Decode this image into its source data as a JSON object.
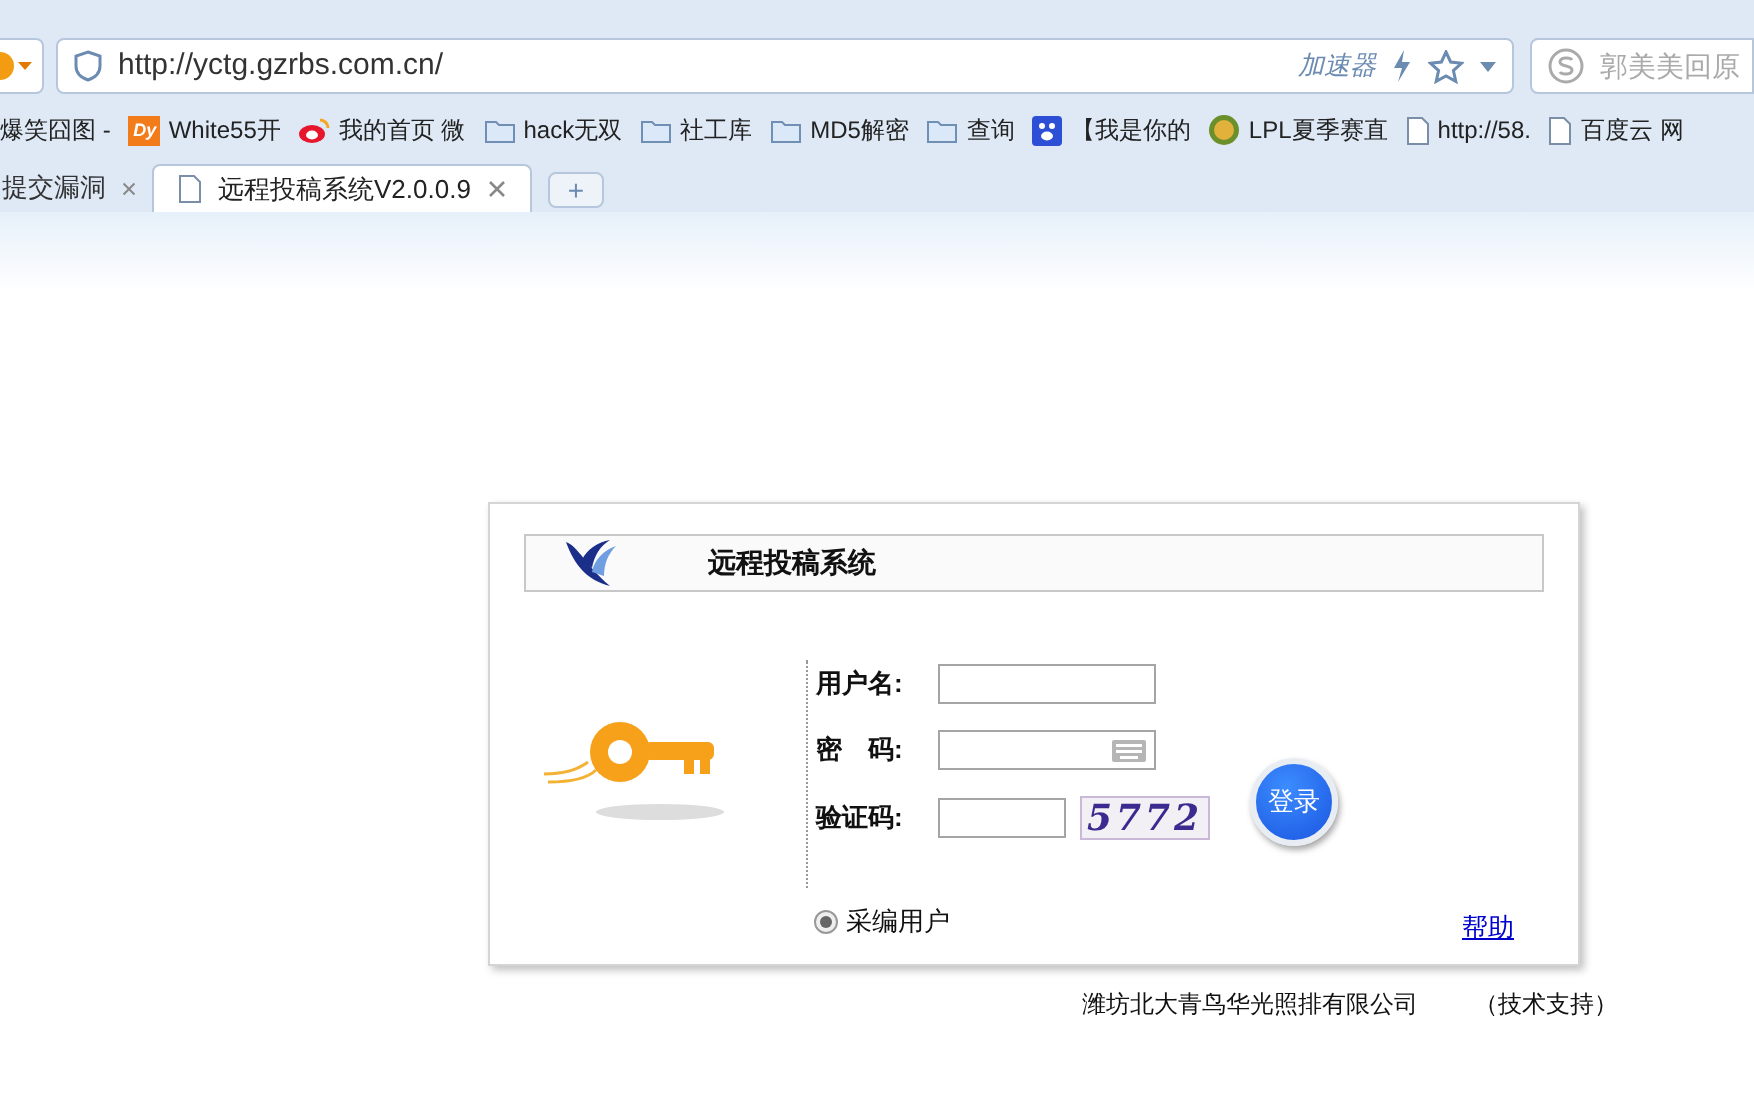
{
  "browser": {
    "address": "http://yctg.gzrbs.com.cn/",
    "accelerator": "加速器",
    "search_placeholder": "郭美美回原",
    "bookmarks": [
      {
        "label": "爆笑囧图 -",
        "kind": "none"
      },
      {
        "label": "White55开",
        "kind": "dy"
      },
      {
        "label": "我的首页 微",
        "kind": "weibo"
      },
      {
        "label": "hack无双",
        "kind": "folder"
      },
      {
        "label": "社工库",
        "kind": "folder"
      },
      {
        "label": "MD5解密",
        "kind": "folder"
      },
      {
        "label": "查询",
        "kind": "folder"
      },
      {
        "label": "【我是你的",
        "kind": "paw"
      },
      {
        "label": "LPL夏季赛直",
        "kind": "game"
      },
      {
        "label": "http://58.",
        "kind": "page"
      },
      {
        "label": "百度云 网",
        "kind": "page"
      }
    ],
    "dy_badge": "Dy",
    "tabs": [
      {
        "label": "提交漏洞",
        "selected": false
      },
      {
        "label": "远程投稿系统V2.0.0.9",
        "selected": true
      }
    ],
    "new_tab": "+"
  },
  "login": {
    "title": "远程投稿系统",
    "fields": [
      {
        "label": "用户名:",
        "kind": "text"
      },
      {
        "label": "密　码:",
        "kind": "password"
      },
      {
        "label": "验证码:",
        "kind": "captcha"
      }
    ],
    "captcha": "5772",
    "submit": "登录",
    "roles": [
      {
        "label": "采编用户",
        "selected": true
      }
    ],
    "help": "帮助"
  },
  "footer": {
    "company": "潍坊北大青鸟华光照排有限公司",
    "support": "（技术支持）"
  }
}
